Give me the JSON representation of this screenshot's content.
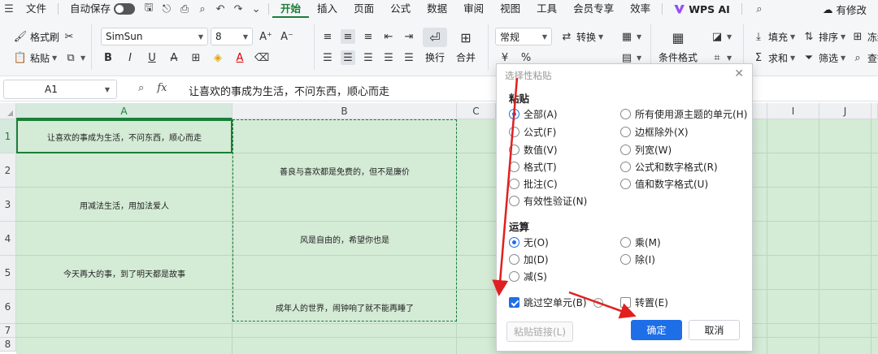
{
  "menubar": {
    "file": "文件",
    "autosave": "自动保存",
    "tabs": [
      "开始",
      "插入",
      "页面",
      "公式",
      "数据",
      "审阅",
      "视图",
      "工具",
      "会员专享",
      "效率"
    ],
    "wps_ai": "WPS AI",
    "edit_status": "有修改"
  },
  "toolbar": {
    "format_painter": "格式刷",
    "paste": "粘贴",
    "font_name": "SimSun",
    "font_size": "8",
    "wrap": "换行",
    "merge": "合并",
    "number_format": "常规",
    "convert": "转换",
    "conditional_format": "条件格式",
    "fill": "填充",
    "sort": "排序",
    "freeze": "冻结",
    "sum": "求和",
    "filter": "筛选",
    "find": "查找"
  },
  "formula_bar": {
    "cell_ref": "A1",
    "fx": "fx",
    "content": "让喜欢的事成为生活，不问东西，顺心而走"
  },
  "grid": {
    "columns": [
      "A",
      "B",
      "C",
      "I",
      "J"
    ],
    "rows": [
      "1",
      "2",
      "3",
      "4",
      "5",
      "6",
      "7",
      "8"
    ],
    "cells": [
      "让喜欢的事成为生活，不问东西，顺心而走",
      "善良与喜欢都是免费的，但不是廉价",
      "用减法生活，用加法爱人",
      "风是自由的，希望你也是",
      "今天再大的事，到了明天都是故事",
      "成年人的世界，闹钟响了就不能再睡了"
    ]
  },
  "dialog": {
    "title": "选择性粘贴",
    "paste_section": "粘贴",
    "paste_options_left": [
      "全部(A)",
      "公式(F)",
      "数值(V)",
      "格式(T)",
      "批注(C)",
      "有效性验证(N)"
    ],
    "paste_options_right": [
      "所有使用源主题的单元(H)",
      "边框除外(X)",
      "列宽(W)",
      "公式和数字格式(R)",
      "值和数字格式(U)"
    ],
    "operation_section": "运算",
    "operation_left": [
      "无(O)",
      "加(D)",
      "减(S)"
    ],
    "operation_right": [
      "乘(M)",
      "除(I)"
    ],
    "skip_blanks": "跳过空单元(B)",
    "transpose": "转置(E)",
    "paste_link": "粘贴链接(L)",
    "ok": "确定",
    "cancel": "取消"
  },
  "colors": {
    "accent_green": "#1a7f37",
    "selection_fill": "#d4ebd6",
    "primary_blue": "#1e6ee8",
    "annotation_red": "#e02020"
  }
}
